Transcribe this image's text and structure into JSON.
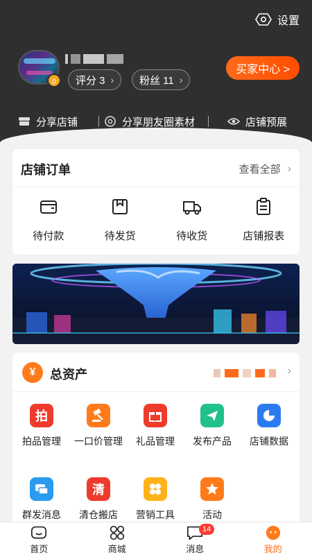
{
  "header": {
    "settings_label": "设置",
    "avatar_badge": "0",
    "score_label": "评分 3",
    "fans_label": "粉丝 11",
    "buyer_center_label": "买家中心 >",
    "shares": [
      "分享店铺",
      "分享朋友圈素材",
      "店铺预展"
    ]
  },
  "orders": {
    "title": "店铺订单",
    "view_all": "查看全部",
    "items": [
      "待付款",
      "待发货",
      "待收货",
      "店铺报表"
    ]
  },
  "assets": {
    "icon_text": "¥",
    "title": "总资产",
    "tools": [
      "拍品管理",
      "一口价管理",
      "礼品管理",
      "发布产品",
      "店铺数据",
      "群发消息",
      "清仓搬店",
      "营销工具",
      "活动"
    ],
    "tool_icon_texts": [
      "拍",
      "",
      "",
      "",
      "",
      "",
      "清",
      "",
      ""
    ]
  },
  "tabbar": {
    "items": [
      "首页",
      "商城",
      "消息",
      "我的"
    ],
    "message_badge": "14",
    "active": "我的"
  },
  "colors": {
    "accent": "#ff6a1a",
    "header_bg": "#2f2f2f",
    "badge_red": "#ff3b30"
  }
}
